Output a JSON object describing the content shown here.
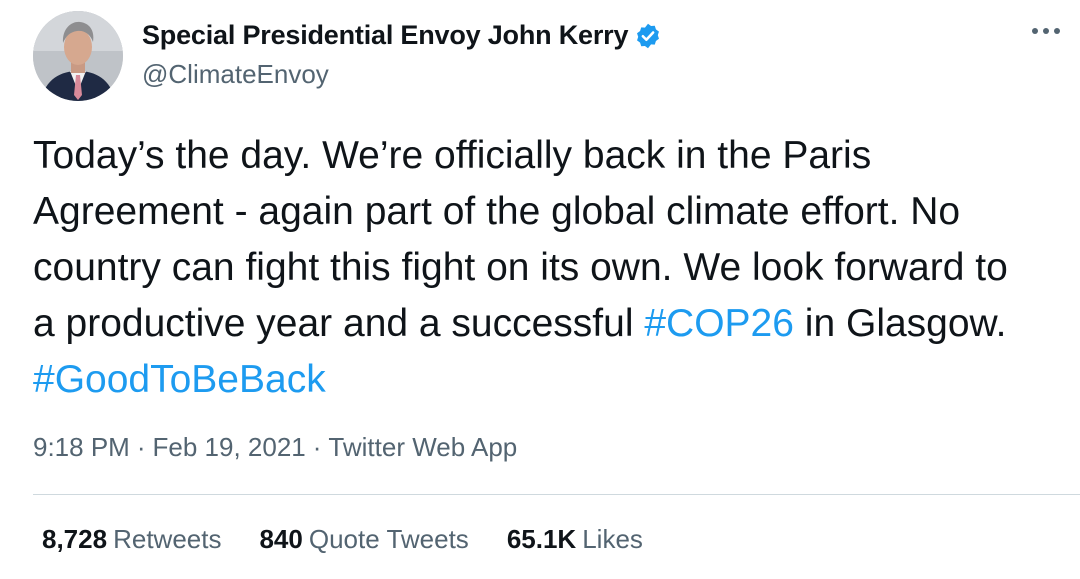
{
  "tweet": {
    "author": {
      "name": "Special Presidential Envoy John Kerry",
      "handle": "@ClimateEnvoy",
      "verified": true,
      "verified_icon": "verified-badge-icon"
    },
    "text_lines": [
      "Today’s the day. We’re officially back in the Paris",
      "Agreement - again part of the global climate effort. No",
      "country can fight this fight on its own. We look forward to"
    ],
    "line4_prefix": "a productive year and a successful",
    "hashtag_cop26": "#COP26",
    "line4_suffix": "in Glasgow.",
    "hashtag_goodtobeback": "#GoodToBeBack",
    "time": "9:18 PM",
    "date": "Feb 19, 2021",
    "separator": "·",
    "source": "Twitter Web App",
    "stats": {
      "retweets_count": "8,728",
      "retweets_label": "Retweets",
      "quote_count": "840",
      "quote_label": "Quote Tweets",
      "likes_count": "65.1K",
      "likes_label": "Likes"
    },
    "more_icon": "more-options-icon"
  },
  "colors": {
    "text": "#0f1419",
    "secondary": "#536471",
    "link": "#1d9bf0",
    "verified": "#1d9bf0",
    "divider": "#cfd9de",
    "background": "#ffffff"
  }
}
